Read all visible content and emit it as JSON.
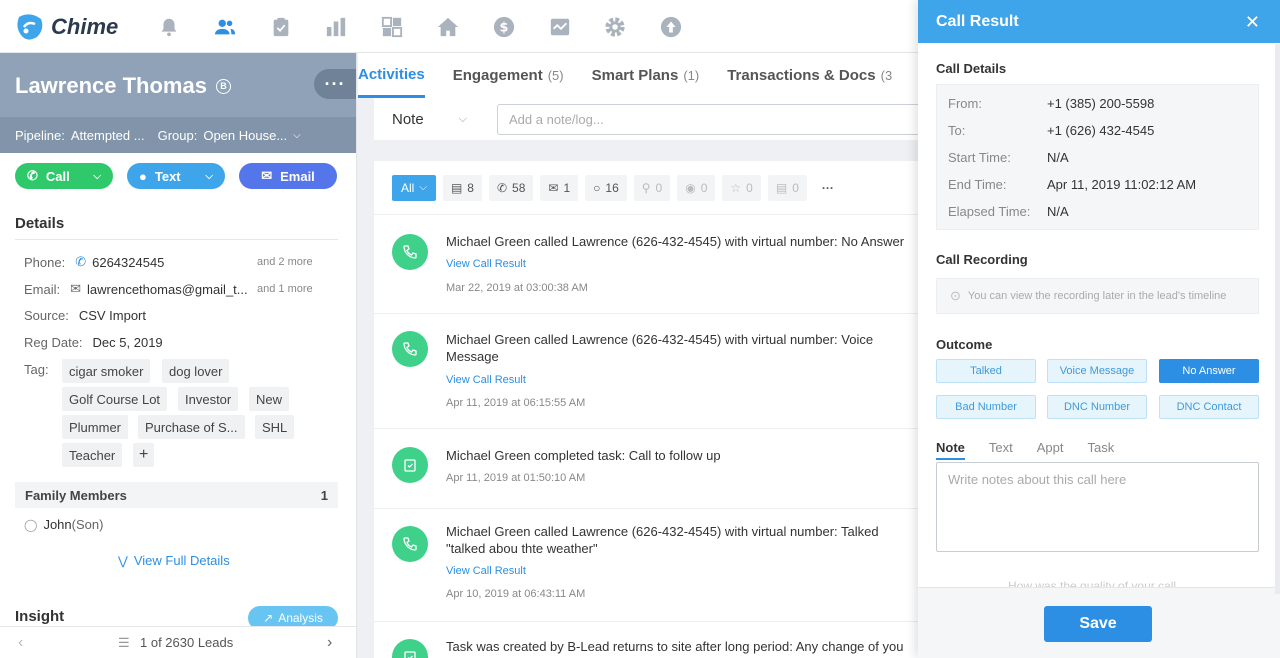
{
  "app": {
    "logo_text": "Chime"
  },
  "nav": {
    "icons": [
      "bell-icon",
      "people-icon",
      "clipboard-icon",
      "bar-chart-icon",
      "grid-icon",
      "home-icon",
      "dollar-icon",
      "activity-chart-icon",
      "gear-icon",
      "upload-icon"
    ]
  },
  "lead": {
    "name": "Lawrence Thomas",
    "badge": "B",
    "more": "···",
    "pipeline_label": "Pipeline:",
    "pipeline_value": "Attempted ...",
    "group_label": "Group:",
    "group_value": "Open House..."
  },
  "actions": {
    "call": "Call",
    "text": "Text",
    "email": "Email"
  },
  "details": {
    "title": "Details",
    "phone_label": "Phone:",
    "phone": "6264324545",
    "phone_more": "and 2 more",
    "email_label": "Email:",
    "email": "lawrencethomas@gmail_t...",
    "email_more": "and 1 more",
    "source_label": "Source:",
    "source": "CSV Import",
    "reg_label": "Reg Date:",
    "reg": "Dec 5, 2019",
    "tag_label": "Tag:",
    "tags": [
      "cigar smoker",
      "dog lover",
      "Golf Course Lot",
      "Investor",
      "New",
      "Plummer",
      "Purchase of S...",
      "SHL",
      "Teacher",
      "+"
    ]
  },
  "family": {
    "title": "Family Members",
    "count": "1",
    "member_name": "John",
    "member_rel": "(Son)"
  },
  "view_full": "View Full Details",
  "insight": {
    "title": "Insight",
    "analysis": "Analysis"
  },
  "pager": {
    "text": "1 of 2630 Leads"
  },
  "tabs": [
    {
      "label": "Activities",
      "count": ""
    },
    {
      "label": "Engagement",
      "count": "(5)"
    },
    {
      "label": "Smart Plans",
      "count": "(1)"
    },
    {
      "label": "Transactions & Docs",
      "count": "(3"
    }
  ],
  "note_bar": {
    "type": "Note",
    "placeholder": "Add a note/log..."
  },
  "filters": [
    {
      "label": "All",
      "icon": "chevron-down-icon"
    },
    {
      "label": "8",
      "icon": "note-icon"
    },
    {
      "label": "58",
      "icon": "phone-icon"
    },
    {
      "label": "1",
      "icon": "mail-icon"
    },
    {
      "label": "16",
      "icon": "chat-icon"
    },
    {
      "label": "0",
      "icon": "search-icon"
    },
    {
      "label": "0",
      "icon": "eye-icon"
    },
    {
      "label": "0",
      "icon": "star-icon"
    },
    {
      "label": "0",
      "icon": "briefcase-icon"
    },
    {
      "label": "···",
      "icon": ""
    }
  ],
  "activities": [
    {
      "text": "Michael Green called Lawrence (626-432-4545) with virtual number: No Answer",
      "link": "View Call Result",
      "date": "Mar 22, 2019 at 03:00:38 AM",
      "icon": "phone-call-icon"
    },
    {
      "text": "Michael Green called Lawrence (626-432-4545) with virtual number: Voice Message",
      "link": "View Call Result",
      "date": "Apr 11, 2019 at 06:15:55 AM",
      "icon": "phone-call-icon"
    },
    {
      "text": "Michael Green completed task: Call to follow up",
      "link": "",
      "date": "Apr 11, 2019 at 01:50:10 AM",
      "icon": "task-check-icon"
    },
    {
      "text": "Michael Green called Lawrence (626-432-4545) with virtual number: Talked \"talked abou thte weather\"",
      "link": "View Call Result",
      "date": "Apr 10, 2019 at 06:43:11 AM",
      "icon": "phone-call-icon"
    },
    {
      "text": "Task was created by B-Lead returns to site after long period: Any change of you",
      "link": "",
      "date": "",
      "icon": "task-check-icon"
    }
  ],
  "panel": {
    "title": "Call Result",
    "call_details_title": "Call Details",
    "from_label": "From:",
    "from": "+1 (385) 200-5598",
    "to_label": "To:",
    "to": "+1 (626) 432-4545",
    "start_label": "Start Time:",
    "start": "N/A",
    "end_label": "End Time:",
    "end": "Apr 11, 2019 11:02:12 AM",
    "elapsed_label": "Elapsed Time:",
    "elapsed": "N/A",
    "recording_title": "Call Recording",
    "recording_text": "You can view the recording later in the lead's timeline",
    "outcome_title": "Outcome",
    "outcomes": [
      "Talked",
      "Voice Message",
      "No Answer",
      "Bad Number",
      "DNC Number",
      "DNC Contact"
    ],
    "selected_outcome": "No Answer",
    "note_tabs": [
      "Note",
      "Text",
      "Appt",
      "Task"
    ],
    "note_placeholder": "Write notes about this call here",
    "quality_text": "How was the quality of your call",
    "save": "Save"
  },
  "colors": {
    "brand_blue": "#3ea5ea",
    "call_green": "#2fc96b",
    "email_blue": "#5575ea",
    "activity_green": "#3fd08a"
  }
}
